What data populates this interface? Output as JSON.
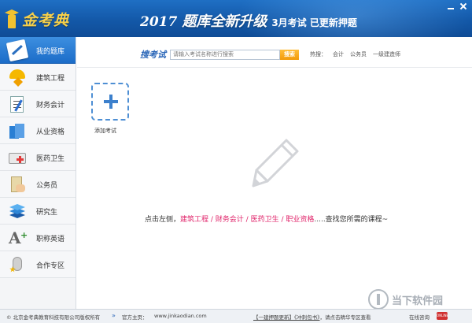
{
  "header": {
    "logo_text": "金考典",
    "banner_year": "2017",
    "banner_main": "题库全新升级",
    "banner_sub": "3月考试 已更新押题"
  },
  "sidebar": {
    "items": [
      {
        "label": "我的题库",
        "icon": "my-library-icon",
        "active": true
      },
      {
        "label": "建筑工程",
        "icon": "construction-helmet-icon"
      },
      {
        "label": "财务会计",
        "icon": "accounting-sheet-icon"
      },
      {
        "label": "从业资格",
        "icon": "books-icon"
      },
      {
        "label": "医药卫生",
        "icon": "medical-kit-icon"
      },
      {
        "label": "公务员",
        "icon": "civil-document-icon"
      },
      {
        "label": "研究生",
        "icon": "layers-icon"
      },
      {
        "label": "职称英语",
        "icon": "letter-a-plus-icon"
      },
      {
        "label": "合作专区",
        "icon": "cooperation-pin-icon"
      }
    ]
  },
  "search": {
    "title": "搜考试",
    "placeholder": "请输入考试名称进行搜索",
    "button": "搜索",
    "hot_label": "热搜：",
    "hot_items": [
      "会计",
      "公务员",
      "一级建造师"
    ]
  },
  "main": {
    "add_exam_label": "添加考试",
    "hint_prefix": "点击左侧，",
    "hint_links": [
      "建筑工程",
      "财务会计",
      "医药卫生",
      "职业资格"
    ],
    "hint_sep": " / ",
    "hint_suffix": ".....查找您所需的课程~"
  },
  "footer": {
    "copyright": "© 北京金考典教育科技有限公司版权所有",
    "home_label": "官方主页：",
    "home_url": "www.jinkaodian.com",
    "link1": "【一建押题更新】",
    "link2": "《冲刺包书》",
    "link_suffix": "，请点击精华专区查看",
    "online": "在线咨询",
    "online_badge": "ONLINE"
  },
  "watermark": {
    "text": "当下软件园"
  },
  "colors": {
    "header_blue": "#1358a8",
    "accent_orange": "#f39a0a",
    "hint_pink": "#e0246a",
    "active_item": "#1c6cc8"
  }
}
